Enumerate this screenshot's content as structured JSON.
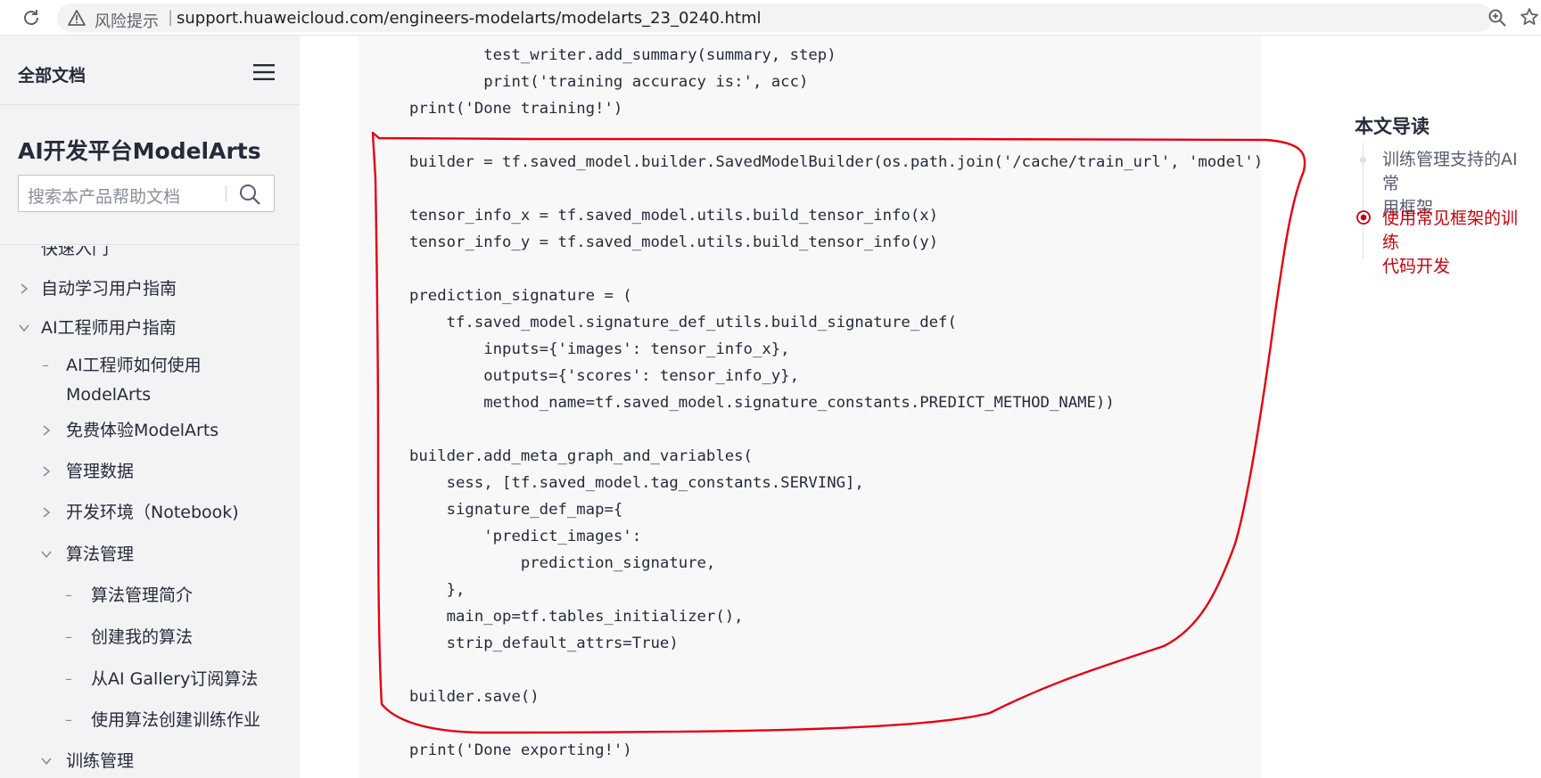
{
  "browser": {
    "risk_label": "风险提示",
    "separator": "|",
    "url": "support.huaweicloud.com/engineers-modelarts/modelarts_23_0240.html",
    "icons": [
      "reload-icon",
      "warning-icon",
      "zoom-icon",
      "star-icon"
    ]
  },
  "sidebar": {
    "all_docs": "全部文档",
    "product_title": "AI开发平台ModelArts",
    "search_placeholder": "搜索本产品帮助文档",
    "items": [
      {
        "label": "快速入门",
        "level": 1,
        "state": "collapsed"
      },
      {
        "label": "自动学习用户指南",
        "level": 1,
        "state": "collapsed"
      },
      {
        "label": "AI工程师用户指南",
        "level": 1,
        "state": "expanded"
      },
      {
        "label": "AI工程师如何使用",
        "label2": "ModelArts",
        "level": 2,
        "state": "leaf"
      },
      {
        "label": "免费体验ModelArts",
        "level": 2,
        "state": "collapsed"
      },
      {
        "label": "管理数据",
        "level": 2,
        "state": "collapsed"
      },
      {
        "label": "开发环境（Notebook)",
        "level": 2,
        "state": "collapsed"
      },
      {
        "label": "算法管理",
        "level": 2,
        "state": "expanded"
      },
      {
        "label": "算法管理简介",
        "level": 3,
        "state": "leaf"
      },
      {
        "label": "创建我的算法",
        "level": 3,
        "state": "leaf"
      },
      {
        "label": "从AI Gallery订阅算法",
        "level": 3,
        "state": "leaf"
      },
      {
        "label": "使用算法创建训练作业",
        "level": 3,
        "state": "leaf"
      },
      {
        "label": "训练管理",
        "level": 2,
        "state": "expanded"
      }
    ]
  },
  "code": {
    "lines": [
      "        test_writer.add_summary(summary, step)",
      "        print('training accuracy is:', acc)",
      "print('Done training!')",
      "",
      "builder = tf.saved_model.builder.SavedModelBuilder(os.path.join('/cache/train_url', 'model'))",
      "",
      "tensor_info_x = tf.saved_model.utils.build_tensor_info(x)",
      "tensor_info_y = tf.saved_model.utils.build_tensor_info(y)",
      "",
      "prediction_signature = (",
      "    tf.saved_model.signature_def_utils.build_signature_def(",
      "        inputs={'images': tensor_info_x},",
      "        outputs={'scores': tensor_info_y},",
      "        method_name=tf.saved_model.signature_constants.PREDICT_METHOD_NAME))",
      "",
      "builder.add_meta_graph_and_variables(",
      "    sess, [tf.saved_model.tag_constants.SERVING],",
      "    signature_def_map={",
      "        'predict_images':",
      "            prediction_signature,",
      "    },",
      "    main_op=tf.tables_initializer(),",
      "    strip_default_attrs=True)",
      "",
      "builder.save()",
      "",
      "print('Done exporting!')"
    ],
    "annotation_color": "#e60012"
  },
  "toc": {
    "title": "本文导读",
    "items": [
      {
        "line1": "训练管理支持的AI常",
        "line2": "用框架",
        "active": false
      },
      {
        "line1": "使用常见框架的训练",
        "line2": "代码开发",
        "active": true
      }
    ],
    "active_color": "#c7000b",
    "normal_color": "#575d6c"
  }
}
